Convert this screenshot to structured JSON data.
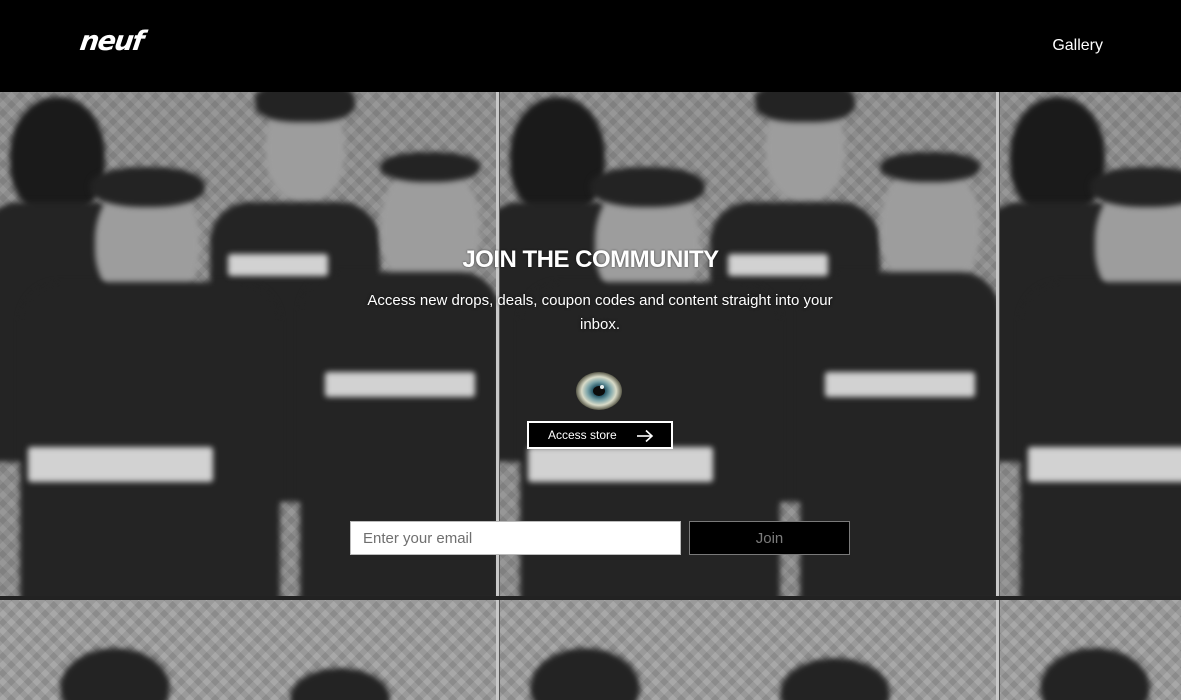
{
  "header": {
    "logo_text": "neuf",
    "nav_gallery": "Gallery"
  },
  "hero": {
    "title": "JOIN THE COMMUNITY",
    "subtitle": "Access new drops, deals, coupon codes and content straight into your inbox.",
    "access_store_label": "Access store",
    "email_placeholder": "Enter your email",
    "join_label": "Join"
  },
  "colors": {
    "header_bg": "#000000",
    "text": "#ffffff",
    "join_text": "#7c7c7c"
  },
  "icons": {
    "logo": "neuf-logo",
    "eye": "eye-icon",
    "arrow": "arrow-right-icon"
  }
}
